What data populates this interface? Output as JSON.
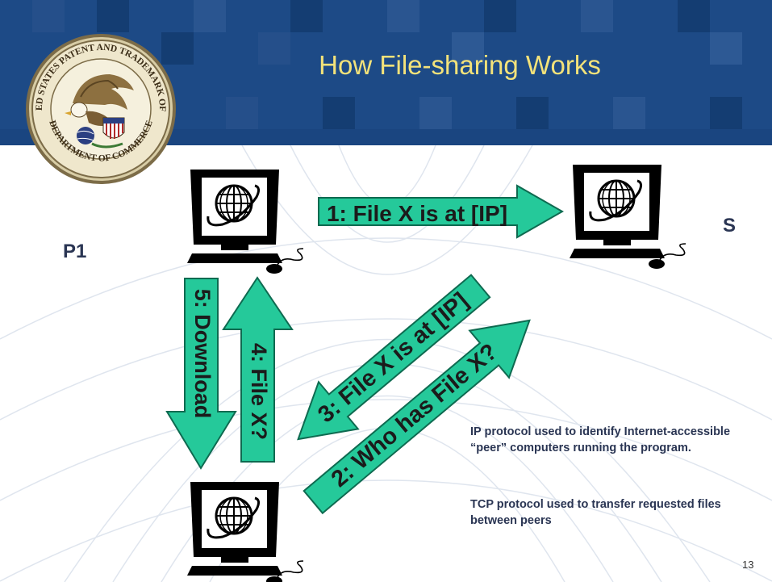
{
  "slide": {
    "title": "How File-sharing Works",
    "page_number": "13",
    "colors": {
      "header": "#1d4a86",
      "title": "#f3e27a",
      "arrow_fill": "#25c99a",
      "label": "#2a3553"
    }
  },
  "seal": {
    "top_text": "UNITED STATES PATENT AND TRADEMARK OFFICE",
    "bottom_text": "DEPARTMENT OF COMMERCE",
    "icon": "eagle-seal-icon"
  },
  "nodes": [
    {
      "id": "p1",
      "label": "P1",
      "icon": "computer-globe-icon"
    },
    {
      "id": "s",
      "label": "S",
      "icon": "computer-globe-icon"
    },
    {
      "id": "p2",
      "label": "",
      "icon": "computer-globe-icon"
    }
  ],
  "arrows": [
    {
      "label": "1: File X is at [IP]"
    },
    {
      "label": "2: Who has File X?"
    },
    {
      "label": "3: File X is at [IP]"
    },
    {
      "label": "4: File X?"
    },
    {
      "label": "5: Download"
    }
  ],
  "notes": [
    "IP protocol used to identify Internet-accessible “peer” computers running the program.",
    "TCP protocol used to transfer requested files between peers"
  ]
}
